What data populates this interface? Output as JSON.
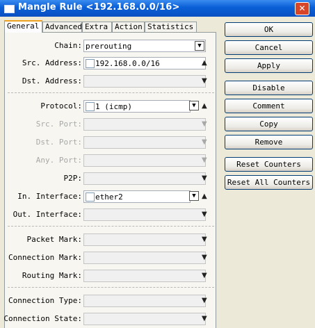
{
  "window": {
    "title": "Mangle Rule <192.168.0.0/16>",
    "close_glyph": "✕"
  },
  "tabs": [
    {
      "label": "General"
    },
    {
      "label": "Advanced"
    },
    {
      "label": "Extra"
    },
    {
      "label": "Action"
    },
    {
      "label": "Statistics"
    }
  ],
  "form": {
    "chain": {
      "label": "Chain:",
      "value": "prerouting"
    },
    "src_address": {
      "label": "Src. Address:",
      "value": "192.168.0.0/16"
    },
    "dst_address": {
      "label": "Dst. Address:"
    },
    "protocol": {
      "label": "Protocol:",
      "value": "1 (icmp)"
    },
    "src_port": {
      "label": "Src. Port:"
    },
    "dst_port": {
      "label": "Dst. Port:"
    },
    "any_port": {
      "label": "Any. Port:"
    },
    "p2p": {
      "label": "P2P:"
    },
    "in_interface": {
      "label": "In. Interface:",
      "value": "ether2"
    },
    "out_interface": {
      "label": "Out. Interface:"
    },
    "packet_mark": {
      "label": "Packet Mark:"
    },
    "connection_mark": {
      "label": "Connection Mark:"
    },
    "routing_mark": {
      "label": "Routing Mark:"
    },
    "connection_type": {
      "label": "Connection Type:"
    },
    "connection_state": {
      "label": "Connection State:"
    }
  },
  "icons": {
    "dropdown": "▼",
    "expand_up": "▲",
    "expand_down": "▼"
  },
  "buttons": {
    "ok": "OK",
    "cancel": "Cancel",
    "apply": "Apply",
    "disable": "Disable",
    "comment": "Comment",
    "copy": "Copy",
    "remove": "Remove",
    "reset_counters": "Reset Counters",
    "reset_all_counters": "Reset All Counters"
  }
}
